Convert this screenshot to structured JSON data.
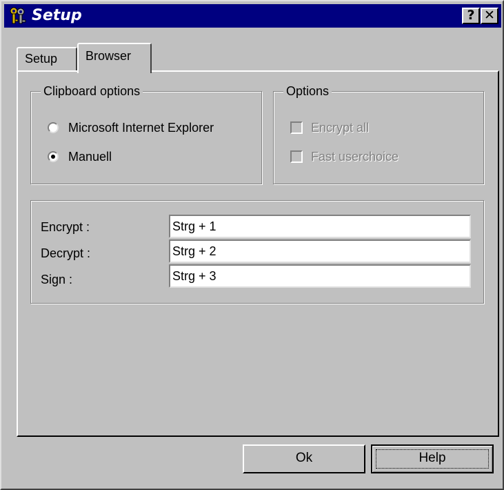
{
  "window": {
    "title": "Setup",
    "help_glyph": "?",
    "close_glyph": "✕"
  },
  "tabs": [
    {
      "label": "Setup",
      "active": false
    },
    {
      "label": "Browser",
      "active": true
    }
  ],
  "clipboard_options": {
    "caption": "Clipboard options",
    "radios": [
      {
        "label": "Microsoft Internet Explorer",
        "checked": false
      },
      {
        "label": "Manuell",
        "checked": true
      }
    ]
  },
  "options": {
    "caption": "Options",
    "checkboxes": [
      {
        "label": "Encrypt all",
        "checked": false,
        "enabled": false
      },
      {
        "label": "Fast userchoice",
        "checked": false,
        "enabled": false
      }
    ]
  },
  "hotkeys": {
    "rows": [
      {
        "label": "Encrypt :",
        "value": "Strg + 1"
      },
      {
        "label": "Decrypt :",
        "value": "Strg + 2"
      },
      {
        "label": "Sign :",
        "value": "Strg + 3"
      }
    ]
  },
  "buttons": {
    "ok": "Ok",
    "help": "Help"
  },
  "colors": {
    "titlebar": "#000080",
    "face": "#c0c0c0"
  }
}
